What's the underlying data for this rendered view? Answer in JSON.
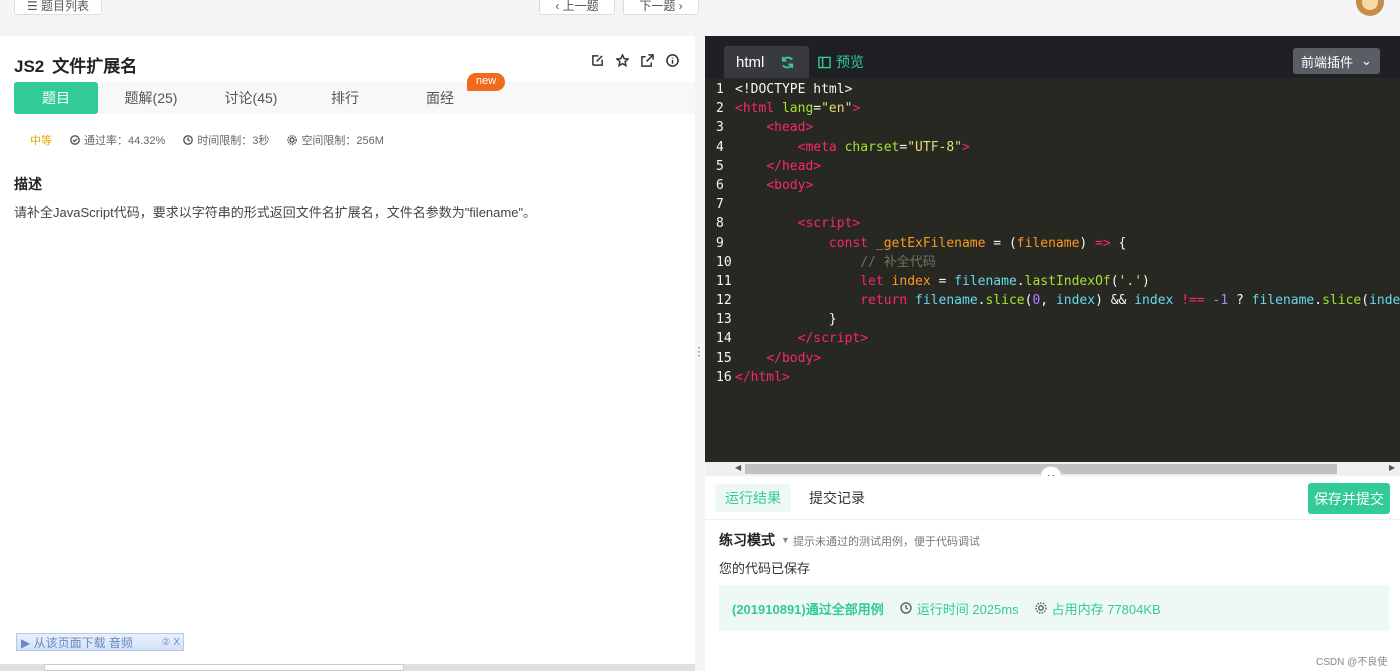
{
  "topbar": {
    "list_label": "☰ 题目列表",
    "prev_label": "‹ 上一题",
    "next_label": "下一题 ›"
  },
  "question": {
    "id": "JS2",
    "title": "文件扩展名",
    "tabs": [
      "题目",
      "题解(25)",
      "讨论(45)",
      "排行",
      "面经"
    ],
    "new_badge": "new",
    "difficulty": "中等",
    "pass_rate": "通过率：44.32%",
    "time_limit": "时间限制：3秒",
    "space_limit": "空间限制：256M",
    "desc_heading": "描述",
    "desc_text": "请补全JavaScript代码，要求以字符串的形式返回文件名扩展名，文件名参数为\"filename\"。"
  },
  "download_bar": {
    "label": "▶ 从该页面下载 音频",
    "help": "②",
    "close": "X"
  },
  "editor": {
    "file_tab": "html",
    "preview_label": "预览",
    "plugin_label": "前端插件",
    "line_numbers": [
      "1",
      "2",
      "3",
      "4",
      "5",
      "6",
      "7",
      "8",
      "9",
      "10",
      "11",
      "12",
      "13",
      "14",
      "15",
      "16"
    ]
  },
  "result": {
    "tabs": [
      "运行结果",
      "提交记录"
    ],
    "submit_label": "保存并提交",
    "mode_label": "练习模式",
    "mode_hint": "提示未通过的测试用例，便于代码调试",
    "saved_text": "您的代码已保存",
    "pass_text": "(201910891)通过全部用例",
    "run_time": "运行时间 2025ms",
    "memory": "占用内存 77804KB"
  },
  "watermark": "CSDN @不良使",
  "colors": {
    "accent": "#32ca99",
    "badge": "#f06b1e",
    "editor_bg": "#272822"
  }
}
